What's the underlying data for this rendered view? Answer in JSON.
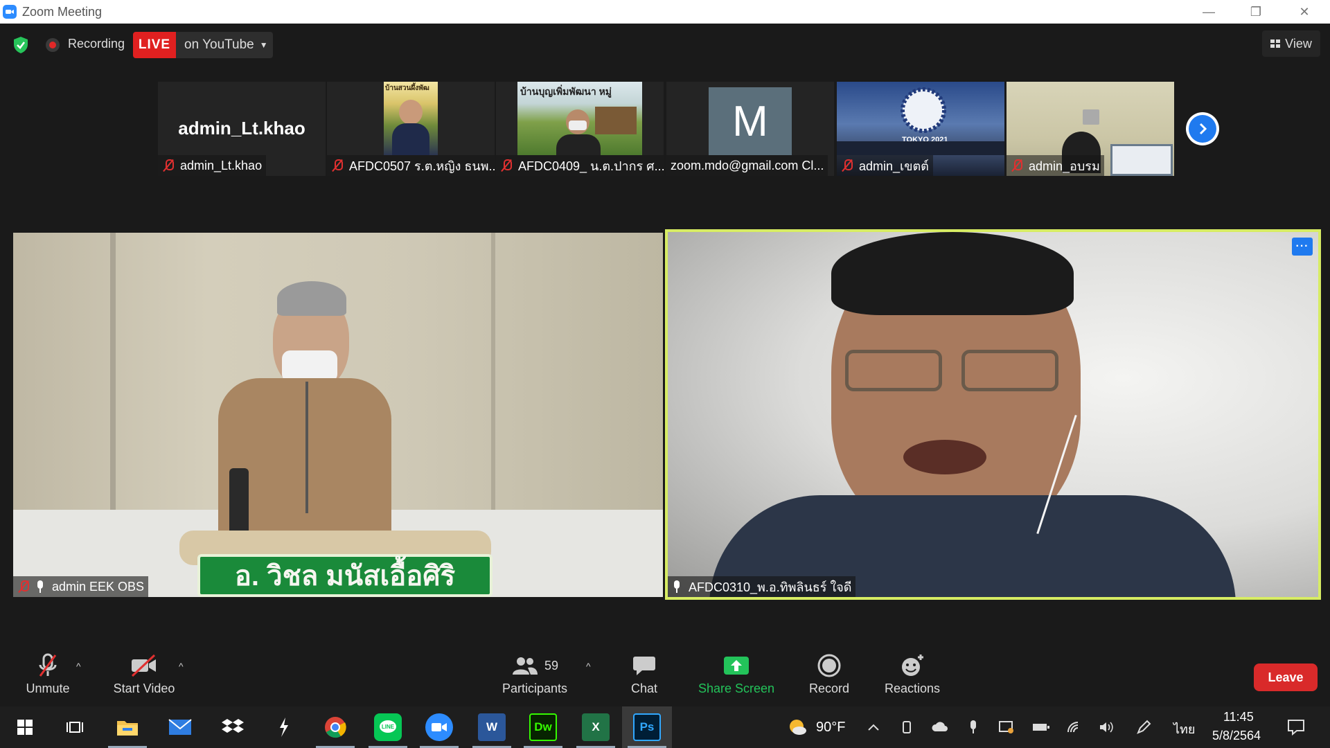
{
  "window": {
    "title": "Zoom Meeting",
    "controls": {
      "minimize": "—",
      "restore": "❐",
      "close": "✕"
    }
  },
  "topbar": {
    "recording_label": "Recording",
    "live_badge": "LIVE",
    "live_destination": "on YouTube",
    "view_label": "View",
    "colors": {
      "live": "#e02020",
      "shield": "#27c45a"
    }
  },
  "thumbnails": [
    {
      "display_name": "admin_Lt.khao",
      "big_name": "admin_Lt.khao",
      "muted": true,
      "icon": "microphone-muted-icon"
    },
    {
      "display_name": "AFDC0507 ร.ต.หญิง ธนพ...",
      "muted": true,
      "banner_text": "บ้านสวนผึ้งพัฒ",
      "icon": "microphone-muted-icon"
    },
    {
      "display_name": "AFDC0409_ น.ต.ปากร ศ...",
      "muted": true,
      "banner_text": "บ้านบุญเพิ่มพัฒนา หมู่",
      "icon": "microphone-muted-icon"
    },
    {
      "display_name": "zoom.mdo@gmail.com Cl...",
      "muted": false,
      "avatar_letter": "M"
    },
    {
      "display_name": "admin_เขตต์",
      "muted": true,
      "banner_text": "TOKYO 2021",
      "icon": "microphone-muted-icon"
    },
    {
      "display_name": "admin_อบรม",
      "muted": true,
      "icon": "microphone-muted-icon"
    }
  ],
  "main_videos": {
    "left": {
      "name": "admin EEK OBS",
      "nameplate": "อ. วิชล  มนัสเอื้อศิริ"
    },
    "right": {
      "name": "AFDC0310_พ.อ.ทิพลินธร์ ใจดี",
      "more": "···",
      "active_speaker_color": "#d7ec63"
    }
  },
  "toolbar": {
    "unmute": "Unmute",
    "start_video": "Start Video",
    "participants": "Participants",
    "participants_count": "59",
    "chat": "Chat",
    "share_screen": "Share Screen",
    "record": "Record",
    "reactions": "Reactions",
    "leave": "Leave",
    "caret": "^",
    "colors": {
      "share": "#23c35a",
      "leave": "#d92a2a"
    }
  },
  "taskbar": {
    "apps": [
      "windows-start",
      "task-view",
      "file-explorer",
      "mail",
      "dropbox",
      "app-lightning",
      "chrome",
      "line",
      "zoom",
      "word",
      "dreamweaver",
      "excel",
      "photoshop"
    ],
    "dw_label": "Dw",
    "ps_label": "Ps",
    "word_label": "W",
    "excel_label": "X",
    "weather": "90°F",
    "language": "ไทย",
    "time": "11:45",
    "date": "5/8/2564"
  }
}
